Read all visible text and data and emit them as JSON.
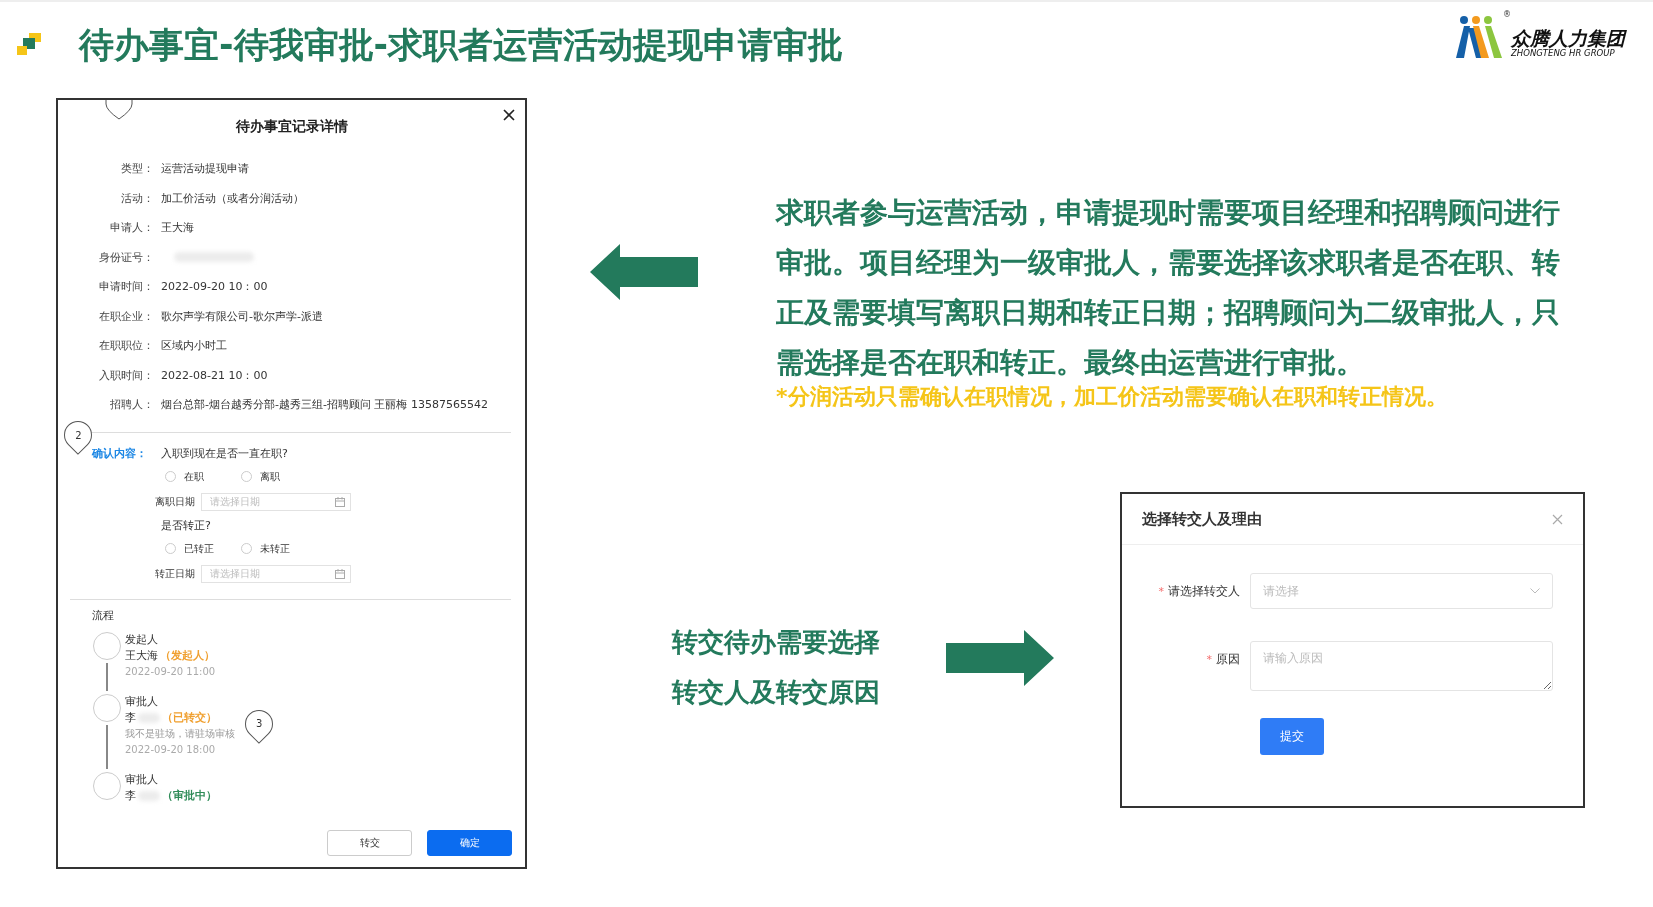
{
  "header": {
    "title": "待办事宜-待我审批-求职者运营活动提现申请审批",
    "brand": {
      "name": "众腾人力集团",
      "subtitle": "ZHONGTENG HR GROUP",
      "mark": "®"
    }
  },
  "detail_dialog": {
    "title": "待办事宜记录详情",
    "fields": [
      {
        "label": "类型：",
        "value": "运营活动提现申请"
      },
      {
        "label": "活动：",
        "value": "加工价活动（或者分润活动）"
      },
      {
        "label": "申请人：",
        "value": "王大海"
      },
      {
        "label": "身份证号：",
        "redacted": true
      },
      {
        "label": "申请时间：",
        "value": "2022-09-20 10：00"
      },
      {
        "label": "在职企业：",
        "value": "歌尔声学有限公司-歌尔声学-派遣"
      },
      {
        "label": "在职职位：",
        "value": "区域内小时工"
      },
      {
        "label": "入职时间：",
        "value": "2022-08-21 10：00"
      },
      {
        "label": "招聘人：",
        "value": "烟台总部-烟台越秀分部-越秀三组-招聘顾问 王丽梅 13587565542"
      }
    ],
    "confirm": {
      "label": "确认内容：",
      "pin": "2",
      "questions": [
        {
          "question": "入职到现在是否一直在职?",
          "options": [
            {
              "label": "在职",
              "selected": false
            },
            {
              "label": "离职",
              "selected": false
            }
          ],
          "date_label": "离职日期",
          "date_placeholder": "请选择日期"
        },
        {
          "question": "是否转正?",
          "options": [
            {
              "label": "已转正",
              "selected": false
            },
            {
              "label": "未转正",
              "selected": false
            }
          ],
          "date_label": "转正日期",
          "date_placeholder": "请选择日期"
        }
      ]
    },
    "flow": {
      "title": "流程",
      "steps": [
        {
          "role": "发起人",
          "person": "王大海",
          "status": "（发起人）",
          "color": "#f0a030",
          "time": "2022-09-20  11:00"
        },
        {
          "role": "审批人",
          "person": "李",
          "redacted": true,
          "status": "（已转交）",
          "color": "#f0a030",
          "note": "我不是驻场，请驻场审核",
          "time": "2022-09-20  18:00",
          "pin": "3"
        },
        {
          "role": "审批人",
          "person": "李",
          "redacted": true,
          "status": "（审批中）",
          "color": "#2e8b57"
        }
      ]
    },
    "buttons": [
      {
        "label": "转交",
        "kind": "default"
      },
      {
        "label": "确定",
        "kind": "primary"
      }
    ]
  },
  "description": {
    "paragraph": "求职者参与运营活动，申请提现时需要项目经理和招聘顾问进行审批。项目经理为一级审批人，需要选择该求职者是否在职、转正及需要填写离职日期和转正日期；招聘顾问为二级审批人，只需选择是否在职和转正。最终由运营进行审批。",
    "note": "*分润活动只需确认在职情况，加工价活动需要确认在职和转正情况。"
  },
  "transfer_note": "转交待办需要选择转交人及转交原因",
  "transfer_dialog": {
    "title": "选择转交人及理由",
    "fields": [
      {
        "label": "请选择转交人",
        "required_mark": "*",
        "kind": "select",
        "placeholder": "请选择"
      },
      {
        "label": "原因",
        "required_mark": "*",
        "kind": "textarea",
        "placeholder": "请输入原因"
      }
    ],
    "submit": "提交"
  }
}
